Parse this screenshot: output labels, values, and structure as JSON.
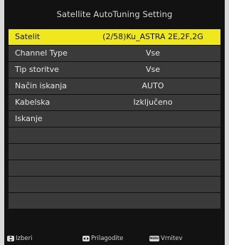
{
  "title": "Satellite AutoTuning Setting",
  "menu": {
    "rows": [
      {
        "label": "Satelit",
        "value": "(2/58)Ku_ASTRA 2E,2F,2G",
        "selected": true
      },
      {
        "label": "Channel Type",
        "value": "Vse"
      },
      {
        "label": "Tip storitve",
        "value": "Vse"
      },
      {
        "label": "Način iskanja",
        "value": "AUTO"
      },
      {
        "label": "Kabelska",
        "value": "Izključeno"
      },
      {
        "label": "Iskanje",
        "value": ""
      },
      {
        "label": "",
        "value": ""
      },
      {
        "label": "",
        "value": ""
      },
      {
        "label": "",
        "value": ""
      },
      {
        "label": "",
        "value": ""
      },
      {
        "label": "",
        "value": ""
      }
    ]
  },
  "footer": {
    "select": {
      "icon": "up-down-arrows-icon",
      "label": "Izberi"
    },
    "adjust": {
      "icon": "left-right-arrows-icon",
      "label": "Prilagodite"
    },
    "back": {
      "icon": "menu-key-icon",
      "icon_text": "MENU",
      "label": "Vrnitev"
    }
  },
  "colors": {
    "selected_row": "#f0e81e",
    "row": "#3a3a3a",
    "background": "#121212"
  }
}
